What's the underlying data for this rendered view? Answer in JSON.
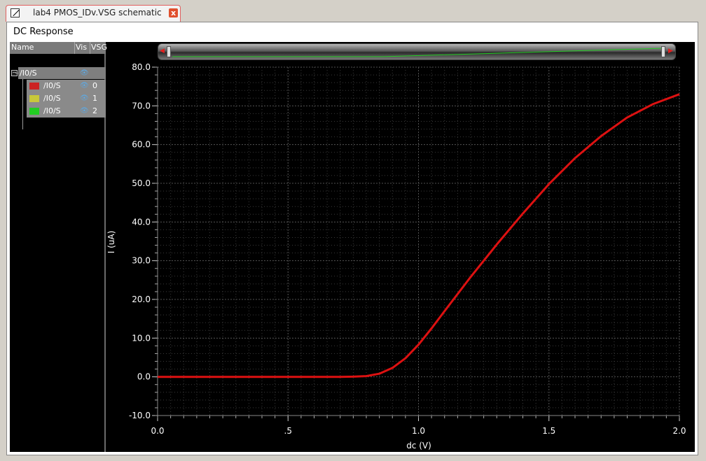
{
  "tab": {
    "title": "lab4 PMOS_IDv.VSG schematic",
    "close_glyph": "x"
  },
  "window": {
    "title": "DC Response"
  },
  "browser": {
    "columns": [
      "Name",
      "Vis",
      "VSG"
    ],
    "root": {
      "name": "/I0/S"
    },
    "rows": [
      {
        "name": "/I0/S",
        "vsg": "0",
        "color": "#cc2222"
      },
      {
        "name": "/I0/S",
        "vsg": "1",
        "color": "#c8c83a"
      },
      {
        "name": "/I0/S",
        "vsg": "2",
        "color": "#22cc22"
      }
    ]
  },
  "chart_data": {
    "type": "line",
    "xlabel": "dc (V)",
    "ylabel": "I (uA)",
    "xlim": [
      0.0,
      2.0
    ],
    "ylim": [
      -10.0,
      80.0
    ],
    "x_ticks": [
      "0.0",
      ".5",
      "1.0",
      "1.5",
      "2.0"
    ],
    "y_ticks": [
      "-10.0",
      "0.0",
      "10.0",
      "20.0",
      "30.0",
      "40.0",
      "50.0",
      "60.0",
      "70.0",
      "80.0"
    ],
    "grid": true,
    "colors": {
      "background": "#000000",
      "grid": "#3a3a3a",
      "axis_text": "#ffffff",
      "trace": "#dd1111"
    },
    "series": [
      {
        "color": "#dd1111",
        "x": [
          0.0,
          0.1,
          0.2,
          0.3,
          0.4,
          0.5,
          0.6,
          0.7,
          0.75,
          0.8,
          0.85,
          0.9,
          0.95,
          1.0,
          1.05,
          1.1,
          1.2,
          1.3,
          1.4,
          1.5,
          1.6,
          1.7,
          1.8,
          1.9,
          2.0
        ],
        "y": [
          0.0,
          0.0,
          0.0,
          0.0,
          0.0,
          0.0,
          0.0,
          0.0,
          0.05,
          0.2,
          0.8,
          2.3,
          4.8,
          8.3,
          12.5,
          17.0,
          25.8,
          34.2,
          42.2,
          49.8,
          56.5,
          62.2,
          67.0,
          70.5,
          73.0
        ]
      }
    ]
  }
}
